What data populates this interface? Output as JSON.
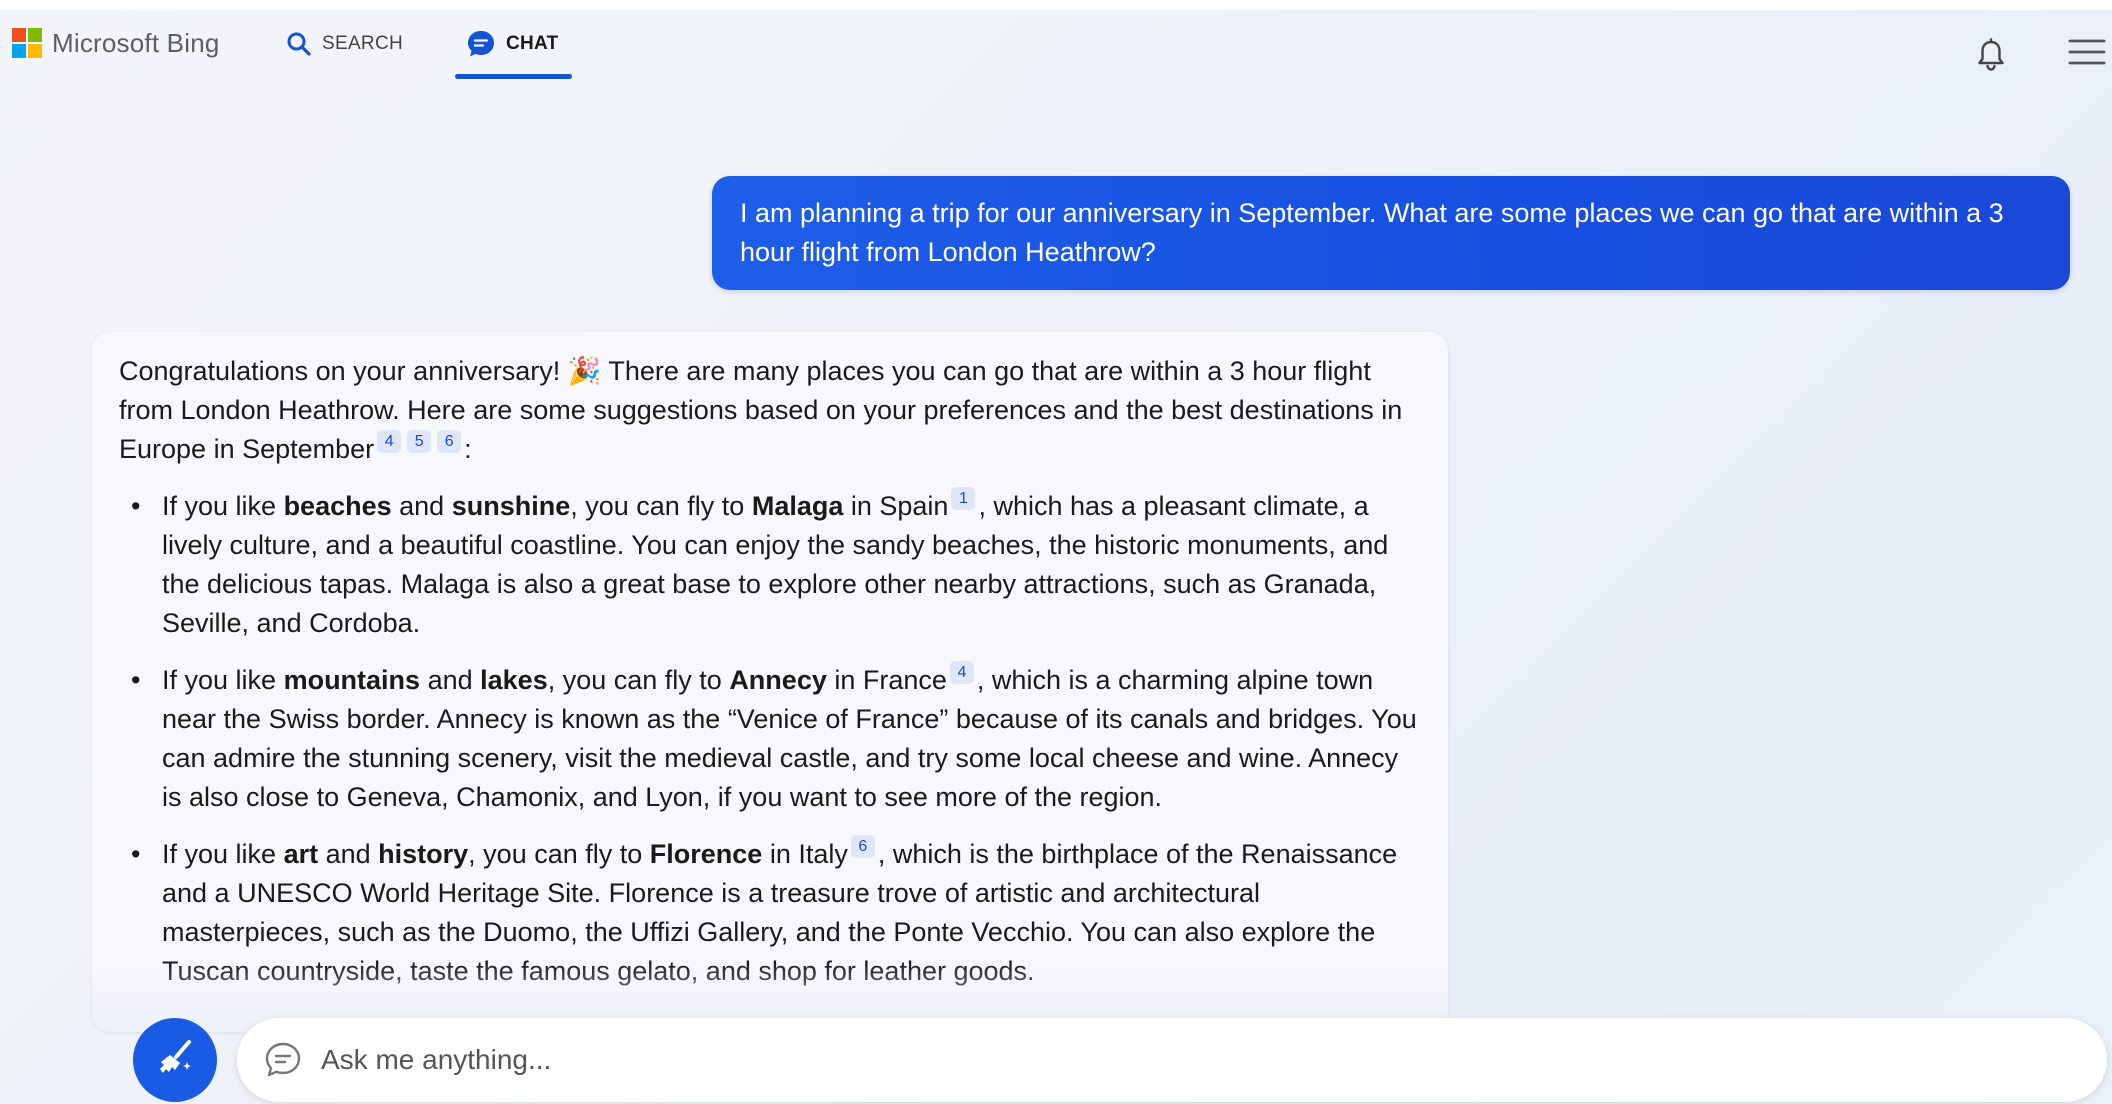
{
  "header": {
    "brand": "Microsoft Bing",
    "logo_colors": [
      "#f25022",
      "#7fba00",
      "#00a4ef",
      "#ffb900"
    ],
    "tabs": [
      {
        "label": "SEARCH",
        "icon": "search-icon",
        "active": false
      },
      {
        "label": "CHAT",
        "icon": "chat-icon",
        "active": true
      }
    ],
    "accent_color": "#1453d3"
  },
  "conversation": {
    "user_message": "I am planning a trip for our anniversary in September. What are some places we can go that are within a 3 hour flight from London Heathrow?",
    "response": {
      "intro_part1": "Congratulations on your anniversary! ",
      "intro_emoji": "🎉",
      "intro_part2": " There are many places you can go that are within a 3 hour flight from London Heathrow. Here are some suggestions based on your preferences and the best destinations in Europe in September",
      "intro_citations": [
        "4",
        "5",
        "6"
      ],
      "intro_end": ":",
      "bullets": [
        {
          "t1": "If you like ",
          "b1": "beaches",
          "t2": " and ",
          "b2": "sunshine",
          "t3": ", you can fly to ",
          "b3": "Malaga",
          "t4": " in Spain",
          "cite": "1",
          "t5": ", which has a pleasant climate, a lively culture, and a beautiful coastline. You can enjoy the sandy beaches, the historic monuments, and the delicious tapas. Malaga is also a great base to explore other nearby attractions, such as Granada, Seville, and Cordoba."
        },
        {
          "t1": "If you like ",
          "b1": "mountains",
          "t2": " and ",
          "b2": "lakes",
          "t3": ", you can fly to ",
          "b3": "Annecy",
          "t4": " in France",
          "cite": "4",
          "t5": ", which is a charming alpine town near the Swiss border. Annecy is known as the “Venice of France” because of its canals and bridges. You can admire the stunning scenery, visit the medieval castle, and try some local cheese and wine. Annecy is also close to Geneva, Chamonix, and Lyon, if you want to see more of the region."
        },
        {
          "t1": "If you like ",
          "b1": "art",
          "t2": " and ",
          "b2": "history",
          "t3": ", you can fly to ",
          "b3": "Florence",
          "t4": " in Italy",
          "cite": "6",
          "t5": ", which is the birthplace of the Renaissance and a UNESCO World Heritage Site. Florence is a treasure trove of artistic and architectural masterpieces, such as the Duomo, the Uffizi Gallery, and the Ponte Vecchio. You can also explore the Tuscan countryside, taste the famous gelato, and shop for leather goods."
        }
      ]
    }
  },
  "composer": {
    "placeholder": "Ask me anything...",
    "new_topic_icon": "broom-icon",
    "chat_icon": "chat-bubble-icon"
  }
}
